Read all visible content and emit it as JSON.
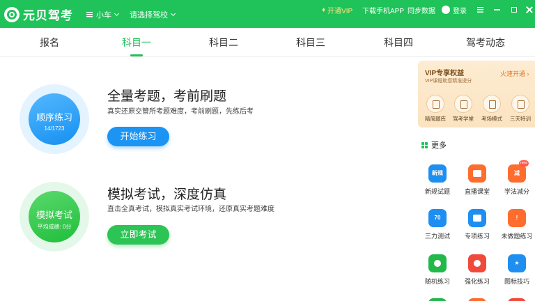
{
  "app": {
    "name": "元贝驾考"
  },
  "titlebar": {
    "vehicle": "小车",
    "school": "请选择驾校",
    "vip": "开通VIP",
    "download": "下载手机APP",
    "sync": "同步数据",
    "login": "登录",
    "accent_color": "#20c25a"
  },
  "tabs": [
    {
      "label": "报名"
    },
    {
      "label": "科目一",
      "active": true
    },
    {
      "label": "科目二"
    },
    {
      "label": "科目三"
    },
    {
      "label": "科目四"
    },
    {
      "label": "驾考动态"
    }
  ],
  "practice": {
    "circle_title": "顺序练习",
    "circle_progress": "14/1723",
    "title": "全量考题，考前刷题",
    "desc": "真实还原交管所考题难度，考前刷题，先练后考",
    "button": "开始练习"
  },
  "exam": {
    "circle_title": "模拟考试",
    "circle_sub": "平均成绩: 0分",
    "title": "模拟考试，深度仿真",
    "desc": "直击全真考试，模拟真实考试环境，还原真实考题难度",
    "button": "立即考试"
  },
  "vip_card": {
    "title": "VIP专享权益",
    "subtitle": "VIP课程助您精准提分",
    "link": "火速开通",
    "features": [
      "精简题库",
      "驾考学堂",
      "考场模式",
      "三天特训"
    ]
  },
  "more": {
    "title": "更多",
    "tools": [
      {
        "label": "新规试题",
        "icon": "new-rules-icon",
        "glyph": "新规",
        "color": "#1e8ff0"
      },
      {
        "label": "直播课堂",
        "icon": "live-video-icon",
        "glyph": "",
        "color": "#ff6d2e"
      },
      {
        "label": "学法减分",
        "icon": "study-reduce-icon",
        "glyph": "减",
        "color": "#ff6d2e",
        "badge": "new"
      },
      {
        "label": "三力测试",
        "icon": "three-power-icon",
        "glyph": "70",
        "color": "#1e8ff0"
      },
      {
        "label": "专项练习",
        "icon": "special-practice-icon",
        "glyph": "",
        "color": "#1e8ff0"
      },
      {
        "label": "未做题练习",
        "icon": "undone-practice-icon",
        "glyph": "!",
        "color": "#ff6d2e"
      },
      {
        "label": "随机练习",
        "icon": "random-practice-icon",
        "glyph": "",
        "color": "#22b84a"
      },
      {
        "label": "强化练习",
        "icon": "intensive-practice-icon",
        "glyph": "",
        "color": "#f04a3c"
      },
      {
        "label": "图标技巧",
        "icon": "icon-tips-icon",
        "glyph": "★",
        "color": "#1e8ff0"
      }
    ]
  }
}
